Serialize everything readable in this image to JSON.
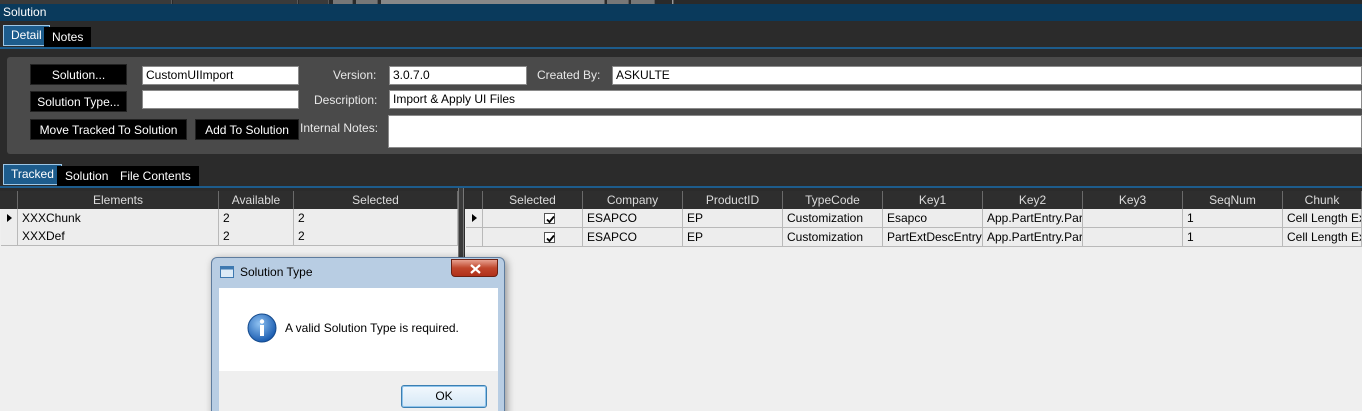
{
  "window": {
    "title": "Solution"
  },
  "top_tabs": [
    {
      "label": "Detail",
      "active": true
    },
    {
      "label": "Notes",
      "active": false
    }
  ],
  "detail": {
    "solution_button": "Solution...",
    "solution_value": "CustomUIImport",
    "solution_type_button": "Solution Type...",
    "solution_type_value": "",
    "move_tracked_button": "Move Tracked To Solution",
    "add_to_solution_button": "Add To Solution",
    "version_label": "Version:",
    "version_value": "3.0.7.0",
    "created_by_label": "Created By:",
    "created_by_value": "ASKULTE",
    "description_label": "Description:",
    "description_value": "Import & Apply UI Files",
    "internal_notes_label": "Internal Notes:",
    "internal_notes_value": ""
  },
  "lower_tabs": [
    {
      "label": "Tracked",
      "active": true
    },
    {
      "label": "Solution",
      "active": false
    },
    {
      "label": "File Contents",
      "active": false
    }
  ],
  "left_grid": {
    "columns": [
      "Elements",
      "Available",
      "Selected"
    ],
    "rows": [
      {
        "cells": [
          "XXXChunk",
          "2",
          "2"
        ],
        "current": true
      },
      {
        "cells": [
          "XXXDef",
          "2",
          "2"
        ],
        "current": false
      }
    ]
  },
  "right_grid": {
    "columns": [
      "Selected",
      "Company",
      "ProductID",
      "TypeCode",
      "Key1",
      "Key2",
      "Key3",
      "SeqNum",
      "Chunk"
    ],
    "rows": [
      {
        "checked": true,
        "cells": [
          "ESAPCO",
          "EP",
          "Customization",
          "Esapco",
          "App.PartEntry.Par",
          "",
          "1",
          "Cell Length Ex"
        ],
        "current": true
      },
      {
        "checked": true,
        "cells": [
          "ESAPCO",
          "EP",
          "Customization",
          "PartExtDescEntry",
          "App.PartEntry.Par",
          "",
          "1",
          "Cell Length Ex"
        ],
        "current": false
      }
    ]
  },
  "dialog": {
    "title": "Solution Type",
    "message": "A valid Solution Type is required.",
    "ok_label": "OK",
    "icon": "info-icon"
  },
  "colors": {
    "title_bar": "#0a3a5c",
    "active_tab": "#1d5c8c",
    "panel": "#4a4a4a",
    "dark_button": "#000000"
  }
}
